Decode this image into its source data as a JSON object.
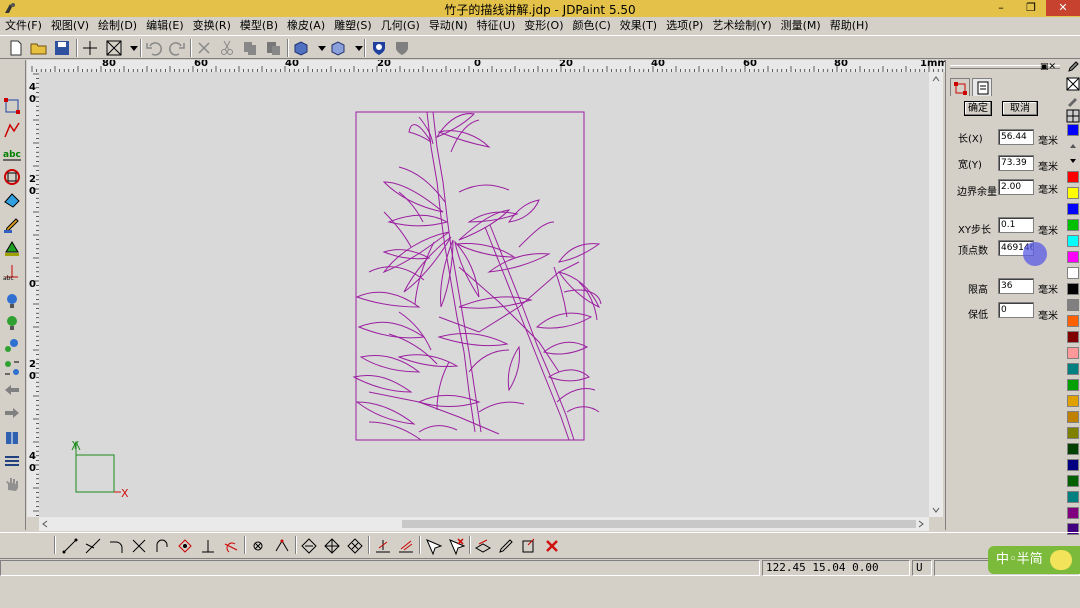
{
  "window": {
    "title": "竹子的描线讲解.jdp - JDPaint 5.50",
    "min_glyph": "–",
    "max_glyph": "❐",
    "close_glyph": "✕"
  },
  "menu": [
    "文件(F)",
    "视图(V)",
    "绘制(D)",
    "编辑(E)",
    "变换(R)",
    "模型(B)",
    "橡皮(A)",
    "雕塑(S)",
    "几何(G)",
    "导动(N)",
    "特征(U)",
    "变形(O)",
    "颜色(C)",
    "效果(T)",
    "选项(P)",
    "艺术绘制(Y)",
    "测量(M)",
    "帮助(H)"
  ],
  "ruler": {
    "h_labels": [
      "80",
      "60",
      "40",
      "20",
      "0",
      "20",
      "40",
      "60",
      "80"
    ],
    "unit": "1mm",
    "v_labels": [
      "4\n0",
      "2\n0",
      "0",
      "2\n0",
      "4\n0"
    ]
  },
  "panel": {
    "confirm_label": "确定",
    "cancel_label": "取消",
    "fields": [
      {
        "label": "长(X)",
        "value": "56.44",
        "unit": "毫米"
      },
      {
        "label": "宽(Y)",
        "value": "73.39",
        "unit": "毫米"
      },
      {
        "label": "边界余量",
        "value": "2.00",
        "unit": "毫米"
      },
      {
        "label": "XY步长",
        "value": "0.1",
        "unit": "毫米"
      },
      {
        "label": "顶点数",
        "value": "469146",
        "unit": ""
      },
      {
        "label": "限高",
        "value": "36",
        "unit": "毫米"
      },
      {
        "label": "保低",
        "value": "0",
        "unit": "毫米"
      }
    ]
  },
  "palette": [
    "#ff0000",
    "#ffff00",
    "#0000ff",
    "#00c000",
    "#00ffff",
    "#ff00ff",
    "#ffffff",
    "#000000",
    "#808080",
    "#ff6000",
    "#800000",
    "#ff9999",
    "#008080",
    "#00a000",
    "#e0a000",
    "#c08000",
    "#808000",
    "#004000",
    "#000080",
    "#006000",
    "#008080",
    "#800080",
    "#400080"
  ],
  "status": {
    "coords": "122.45 15.04 0.00",
    "mode": "U"
  },
  "ime": {
    "label": "中◦半简"
  },
  "axis": {
    "y_label": "Y",
    "x_label": "X"
  },
  "drawing": {
    "stroke_color": "#9b1fa0"
  }
}
